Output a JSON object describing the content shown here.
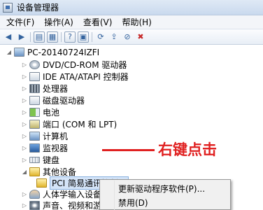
{
  "window": {
    "title": "设备管理器"
  },
  "menubar": {
    "items": [
      "文件(F)",
      "操作(A)",
      "查看(V)",
      "帮助(H)"
    ]
  },
  "toolbar": {
    "icons": [
      "back-icon",
      "forward-icon",
      "show-hide-icon",
      "properties-icon",
      "help-icon",
      "action-icon",
      "scan-icon",
      "update-driver-icon",
      "disable-icon",
      "uninstall-icon"
    ]
  },
  "tree": {
    "root": "PC-20140724IZFI",
    "categories": [
      {
        "label": "DVD/CD-ROM 驱动器",
        "icon": "dvd-drive-icon"
      },
      {
        "label": "IDE ATA/ATAPI 控制器",
        "icon": "ide-controller-icon"
      },
      {
        "label": "处理器",
        "icon": "processor-icon"
      },
      {
        "label": "磁盘驱动器",
        "icon": "disk-drive-icon"
      },
      {
        "label": "电池",
        "icon": "battery-icon"
      },
      {
        "label": "端口 (COM 和 LPT)",
        "icon": "port-icon"
      },
      {
        "label": "计算机",
        "icon": "computer-icon"
      },
      {
        "label": "监视器",
        "icon": "monitor-icon"
      },
      {
        "label": "键盘",
        "icon": "keyboard-icon"
      },
      {
        "label": "其他设备",
        "icon": "other-devices-icon"
      },
      {
        "label": "人体学输入设备",
        "icon": "hid-icon"
      },
      {
        "label": "声音、视频和游戏",
        "icon": "sound-icon"
      }
    ],
    "selected_device": "PCI 简易通讯控制器"
  },
  "annotation": {
    "text": "右键点击",
    "color": "#e02020"
  },
  "context_menu": {
    "items": [
      "更新驱动程序软件(P)...",
      "禁用(D)"
    ]
  }
}
